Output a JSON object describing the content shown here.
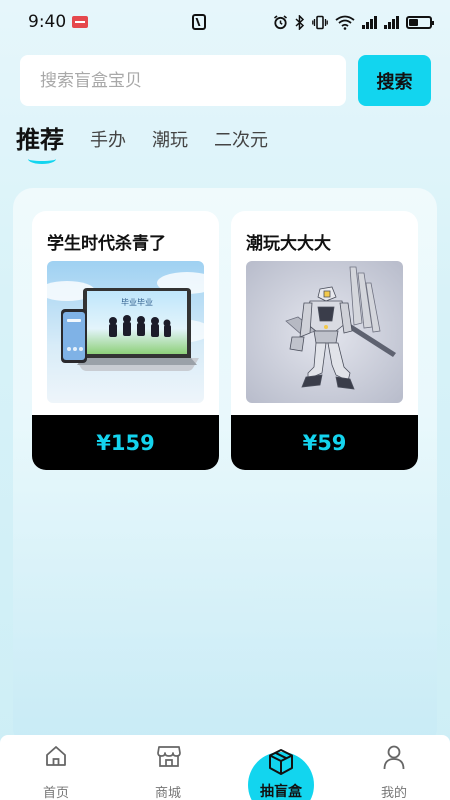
{
  "status": {
    "time": "9:40",
    "wifi_rate": ""
  },
  "search": {
    "placeholder": "搜索盲盒宝贝",
    "button_label": "搜索"
  },
  "tabs": [
    {
      "label": "推荐",
      "active": true
    },
    {
      "label": "手办",
      "active": false
    },
    {
      "label": "潮玩",
      "active": false
    },
    {
      "label": "二次元",
      "active": false
    }
  ],
  "products": [
    {
      "title": "学生时代杀青了",
      "price": "¥159",
      "laptop_screen_text": "毕业毕业"
    },
    {
      "title": "潮玩大大大",
      "price": "¥59"
    }
  ],
  "nav": {
    "home": "首页",
    "shop": "商城",
    "box": "抽盲盒",
    "mine": "我的"
  },
  "colors": {
    "accent": "#12d5ef",
    "price": "#14d4ee"
  }
}
